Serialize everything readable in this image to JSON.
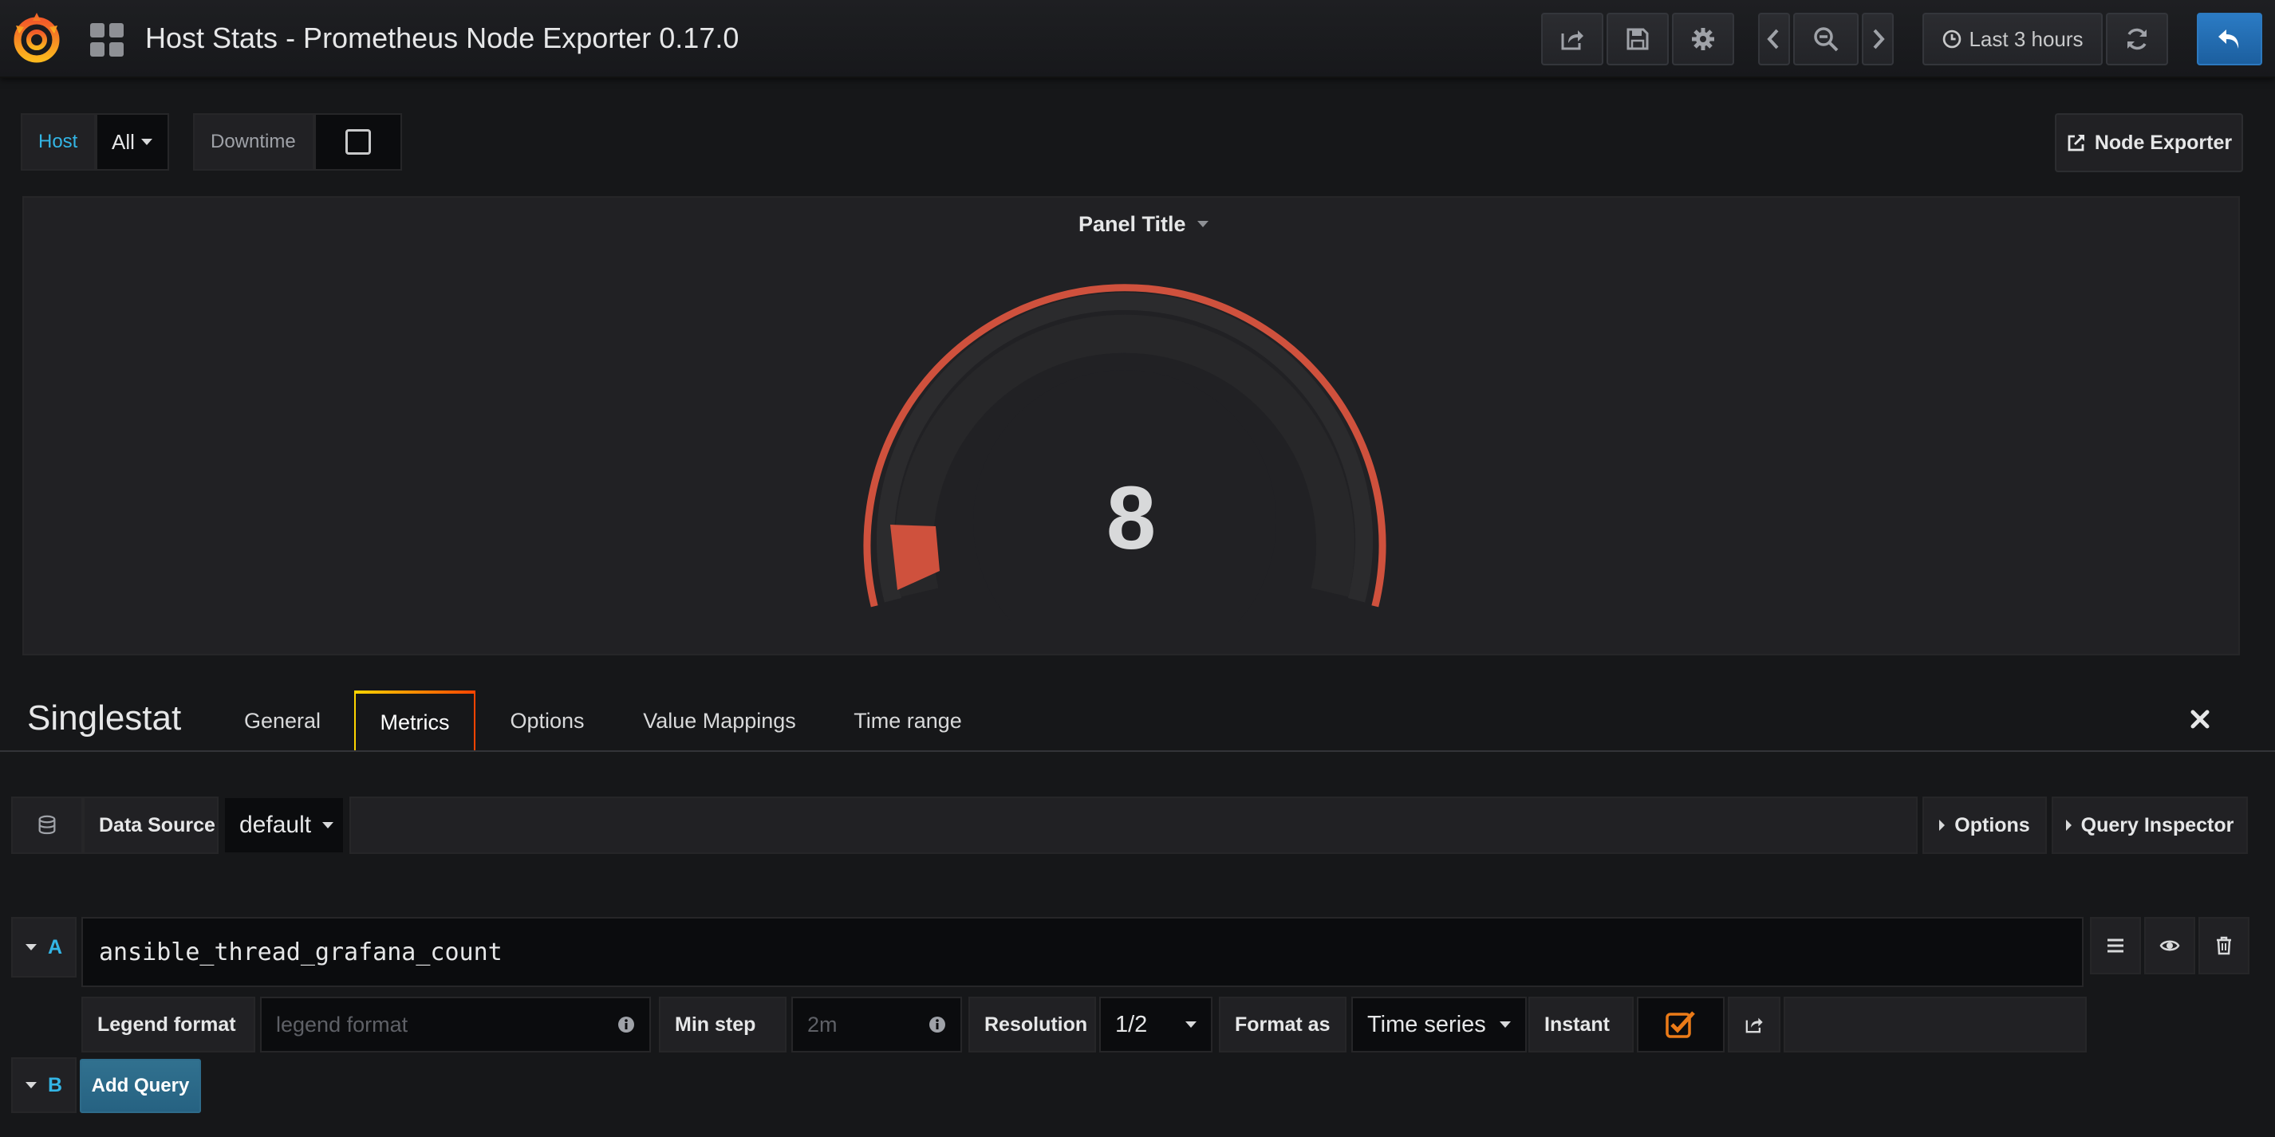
{
  "navbar": {
    "title": "Host Stats - Prometheus Node Exporter 0.17.0",
    "time_range": "Last 3 hours",
    "icons": [
      "share-icon",
      "save-icon",
      "gear-icon",
      "chevron-left-icon",
      "zoom-out-icon",
      "chevron-right-icon",
      "clock-icon",
      "refresh-icon",
      "back-arrow-icon"
    ]
  },
  "variables": {
    "host_label": "Host",
    "host_value": "All",
    "downtime_label": "Downtime"
  },
  "dashboard_link": {
    "label": "Node Exporter"
  },
  "panel": {
    "title": "Panel Title",
    "value": "8",
    "gauge_color": "#cf513d",
    "gauge_threshold_fill": 0.06
  },
  "editor": {
    "title": "Singlestat",
    "tabs": [
      "General",
      "Metrics",
      "Options",
      "Value Mappings",
      "Time range"
    ],
    "active_tab": "Metrics"
  },
  "datasource": {
    "label": "Data Source",
    "value": "default",
    "options_label": "Options",
    "inspector_label": "Query Inspector"
  },
  "query_a": {
    "letter": "A",
    "expr": "ansible_thread_grafana_count",
    "legend_label": "Legend format",
    "legend_placeholder": "legend format",
    "minstep_label": "Min step",
    "minstep_placeholder": "2m",
    "resolution_label": "Resolution",
    "resolution_value": "1/2",
    "format_label": "Format as",
    "format_value": "Time series",
    "instant_label": "Instant",
    "instant_checked": true
  },
  "query_b": {
    "letter": "B",
    "add_label": "Add Query"
  },
  "colors": {
    "accent_orange": "#eb7b18",
    "link_blue": "#33b5e5",
    "primary_blue": "#1f60a0"
  }
}
